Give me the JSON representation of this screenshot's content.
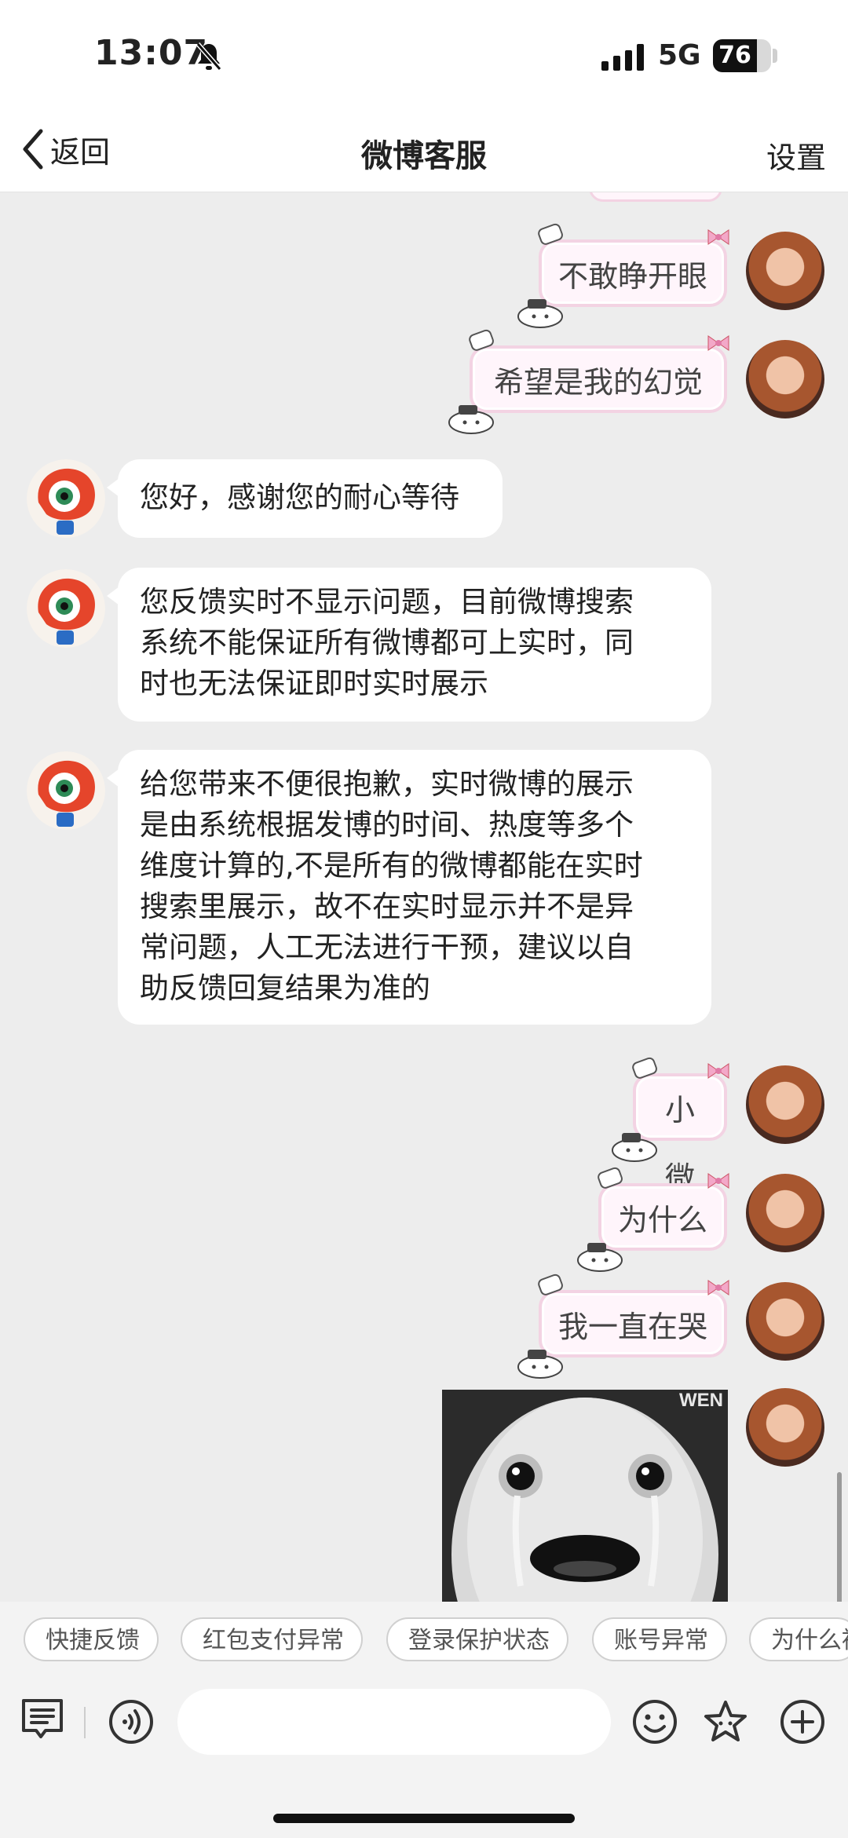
{
  "status_bar": {
    "time": "13:07",
    "network": "5G",
    "battery": "76",
    "battery_level": 0.76
  },
  "nav": {
    "back_label": "返回",
    "title": "微博客服",
    "settings_label": "设置"
  },
  "messages": {
    "user_1": "不敢睁开眼",
    "user_2": "希望是我的幻觉",
    "bot_1": "您好，感谢您的耐心等待",
    "bot_2_lines": [
      "您反馈实时不显示问题，目前微博搜索",
      "系统不能保证所有微博都可上实时，同",
      "时也无法保证即时实时展示"
    ],
    "bot_3_lines": [
      "给您带来不便很抱歉，实时微博的展示",
      "是由系统根据发博的时间、热度等多个",
      "维度计算的,不是所有的微博都能在实时",
      "搜索里展示，故不在实时显示并不是异",
      "常问题，人工无法进行干预，建议以自",
      "助反馈回复结果为准的"
    ],
    "user_3": "小微",
    "user_4": "为什么",
    "user_5": "我一直在哭",
    "image_watermark": "WEN"
  },
  "quick_replies": [
    "快捷反馈",
    "红包支付异常",
    "登录保护状态",
    "账号异常",
    "为什么被"
  ],
  "input": {
    "placeholder": ""
  },
  "colors": {
    "chat_bg": "#ededed",
    "bubble_user_border": "#f3d3e3",
    "bubble_bot": "#ffffff"
  }
}
